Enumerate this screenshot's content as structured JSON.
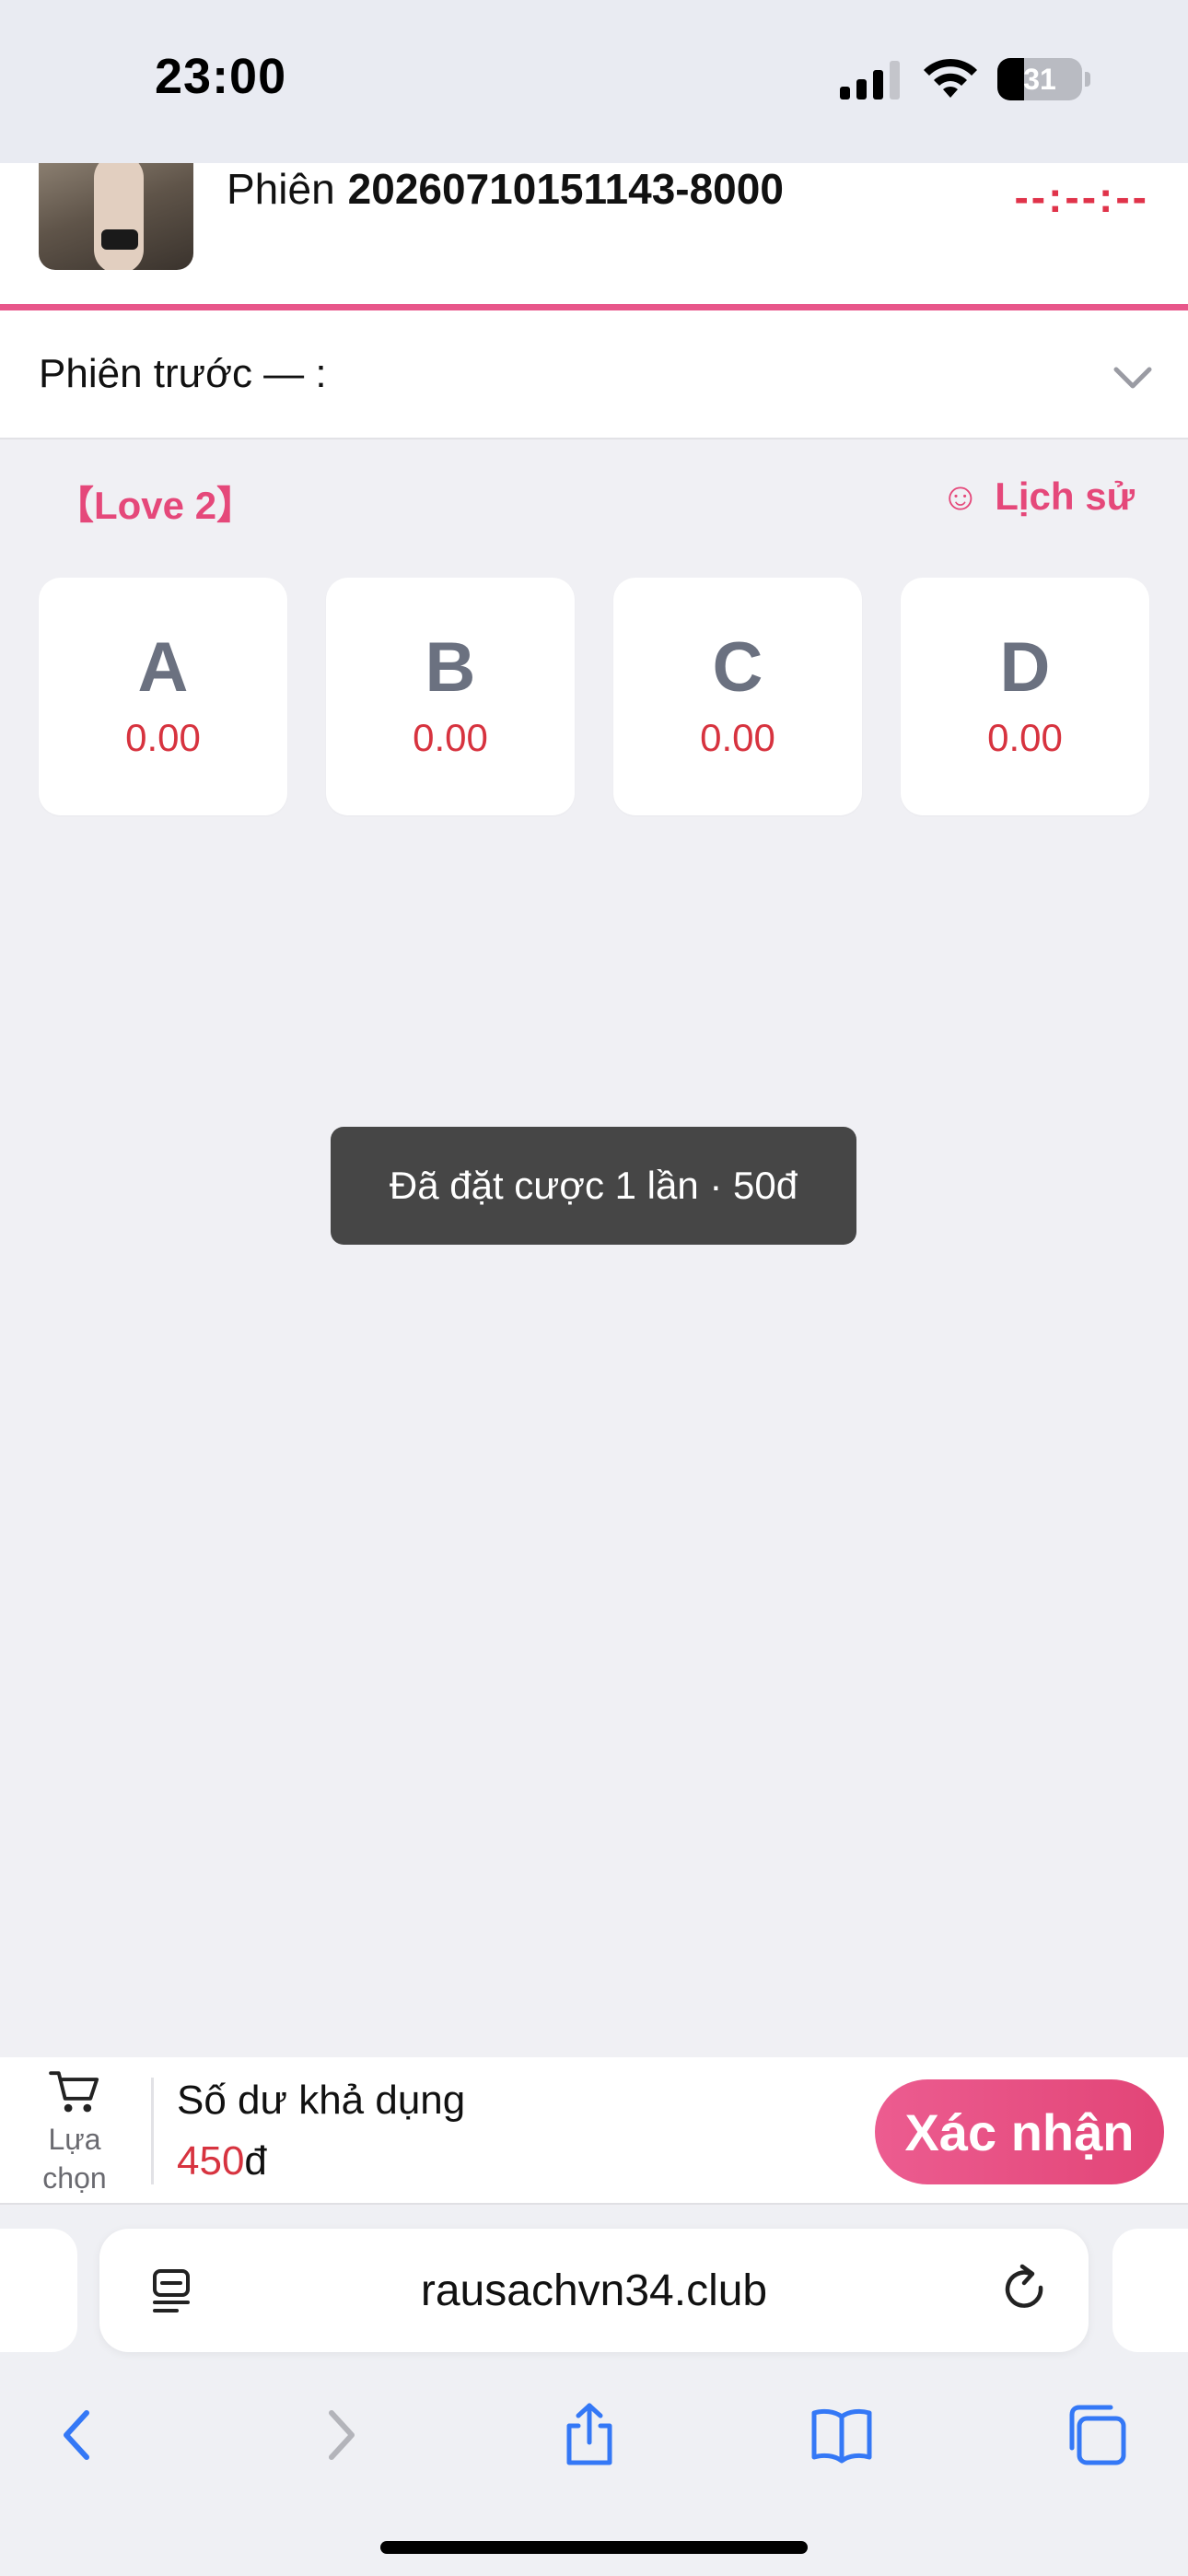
{
  "status_bar": {
    "time": "23:00",
    "battery_level": "31",
    "icons": [
      "signal-icon",
      "wifi-icon",
      "battery-icon"
    ]
  },
  "session": {
    "prefix": "Phiên",
    "code": "20260710151143-8000",
    "countdown": "--:--:--"
  },
  "previous_session": {
    "label": "Phiên trước — :"
  },
  "game": {
    "name": "【Love 2】",
    "history_icon": "☺",
    "history_label": "Lịch sử",
    "options": [
      {
        "letter": "A",
        "odds": "0.00"
      },
      {
        "letter": "B",
        "odds": "0.00"
      },
      {
        "letter": "C",
        "odds": "0.00"
      },
      {
        "letter": "D",
        "odds": "0.00"
      }
    ]
  },
  "toast": {
    "message": "Đã đặt cược 1 lần · 50đ"
  },
  "bet_bar": {
    "cart_label": "Lựa chọn",
    "balance_label": "Số dư khả dụng",
    "balance_amount": "450",
    "balance_currency": "đ",
    "confirm_label": "Xác nhận"
  },
  "browser": {
    "url": "rausachvn34.club",
    "toolbar_icons": [
      "back-icon",
      "forward-icon",
      "share-icon",
      "bookmarks-icon",
      "tabs-icon"
    ]
  },
  "colors": {
    "accent_pink": "#e5487a",
    "odds_red": "#d7333f",
    "ios_blue": "#3478f6"
  }
}
